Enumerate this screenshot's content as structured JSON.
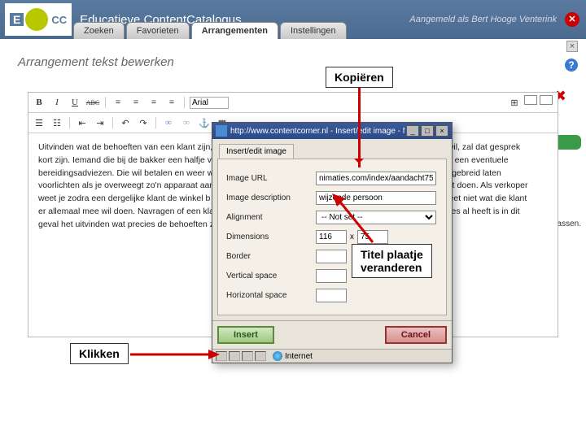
{
  "header": {
    "logo_small": "E",
    "logo_sub": "CC",
    "brand": "Educatieve ContentCatalogus",
    "tabs": [
      "Zoeken",
      "Favorieten",
      "Arrangementen",
      "Instellingen"
    ],
    "active_tab": 2,
    "status": "Aangemeld als Bert Hooge Venterink"
  },
  "page": {
    "title": "Arrangement tekst bewerken",
    "assen": "assen."
  },
  "toolbar": {
    "bold": "B",
    "italic": "I",
    "underline": "U",
    "strike": "ABC",
    "font": "Arial"
  },
  "body_left": "Uitvinden wat de behoeften van een klant zijn, \nkort zijn. Iemand die bij de bakker een halfje v\nbereidingsadviezen. Die wil betalen en weer w\nvoorlichten als je overweegt zo'n apparaat aan\nweet je zodra een dergelijke klant de winkel b\ner allemaal mee wil doen. Navragen of een kla\ngeval het uitvinden wat precies de behoeften z",
  "body_right": "t wil, zal dat gesprek\nen een eventuele\nuitgebreid laten\nunt doen. Als verkoper\nweet niet wat die klant\nulles al heeft is in dit",
  "dialog": {
    "titlebar": "http://www.contentcorner.nl - Insert/edit image - Microso...",
    "tab": "Insert/edit image",
    "labels": {
      "url": "Image URL",
      "desc": "Image description",
      "align": "Alignment",
      "dim": "Dimensions",
      "border": "Border",
      "vspace": "Vertical space",
      "hspace": "Horizontal space"
    },
    "values": {
      "url": "nimaties.com/index/aandacht75.gif",
      "desc": "wijzende persoon",
      "align": "-- Not set --",
      "dim_w": "116",
      "dim_h": "75",
      "border": "",
      "vspace": "",
      "hspace": ""
    },
    "buttons": {
      "insert": "Insert",
      "cancel": "Cancel"
    },
    "status": "Internet"
  },
  "annotations": {
    "copy": "Kopiëren",
    "title_change": "Titel plaatje veranderen",
    "click": "Klikken"
  }
}
